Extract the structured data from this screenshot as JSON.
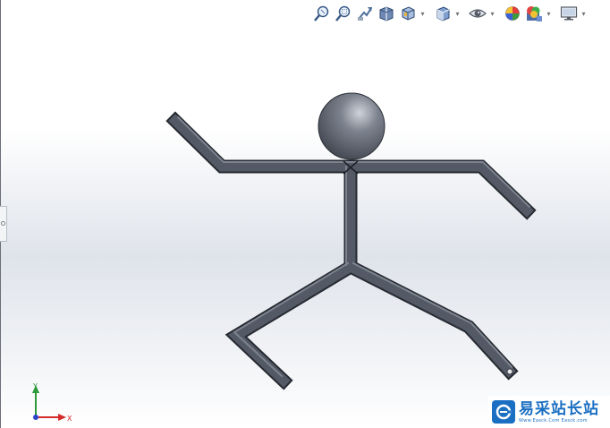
{
  "toolbar": {
    "icons": [
      "zoom-to-fit-icon",
      "zoom-to-area-icon",
      "previous-view-icon",
      "section-view-icon",
      "view-orientation-icon",
      "display-style-icon",
      "hide-show-items-icon",
      "edit-appearance-icon",
      "apply-scene-icon",
      "view-settings-icon"
    ]
  },
  "triad": {
    "y_label": "Y",
    "x_label": "X"
  },
  "colors": {
    "tube": "#4d535e",
    "tube_edge": "#2b2f36",
    "triad_y": "#2e9a3a",
    "triad_x": "#d62b2b",
    "triad_z": "#2b46c8",
    "watermark": "#1b6fc2"
  },
  "watermark": {
    "title": "易采站长站",
    "subtitle": "Www.Easck.Com  Easck.com"
  }
}
